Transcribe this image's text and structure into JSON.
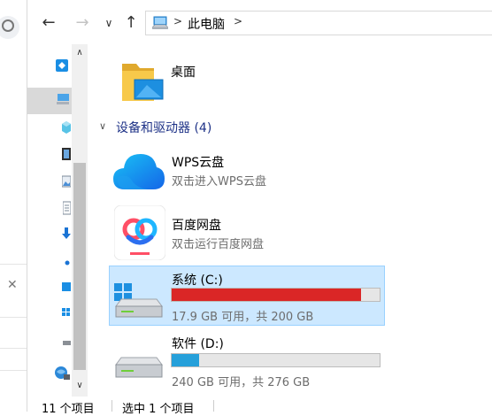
{
  "address": {
    "location_label": "此电脑",
    "separator": ">"
  },
  "nav_buttons": {
    "back": "←",
    "forward": "→",
    "recent": "∨",
    "up": "↑"
  },
  "scrollbar": {
    "up_arrow": "∧",
    "down_arrow": "∨"
  },
  "content": {
    "folder": {
      "name": "桌面",
      "icon": "desktop-folder-icon"
    },
    "group": {
      "chevron": "∨",
      "label": "设备和驱动器 (4)"
    },
    "items": [
      {
        "name": "WPS云盘",
        "subtitle": "双击进入WPS云盘",
        "icon": "wps-cloud-icon"
      },
      {
        "name": "百度网盘",
        "subtitle": "双击运行百度网盘",
        "icon": "baidu-netdisk-icon"
      }
    ],
    "drives": [
      {
        "name": "系统 (C:)",
        "usage_text": "17.9 GB 可用，共 200 GB",
        "used_fraction": 0.91,
        "bar_color": "#da2626",
        "selected": true
      },
      {
        "name": "软件 (D:)",
        "usage_text": "240 GB 可用，共 276 GB",
        "used_fraction": 0.13,
        "bar_color": "#26a0da",
        "selected": false
      }
    ]
  },
  "status": {
    "count": "11 个项目",
    "selection": "选中 1 个项目"
  },
  "other_window": {
    "close_glyph": "✕"
  },
  "colors": {
    "selection_bg": "#cce8ff",
    "selection_border": "#99d1ff",
    "group_header": "#1e3287"
  }
}
